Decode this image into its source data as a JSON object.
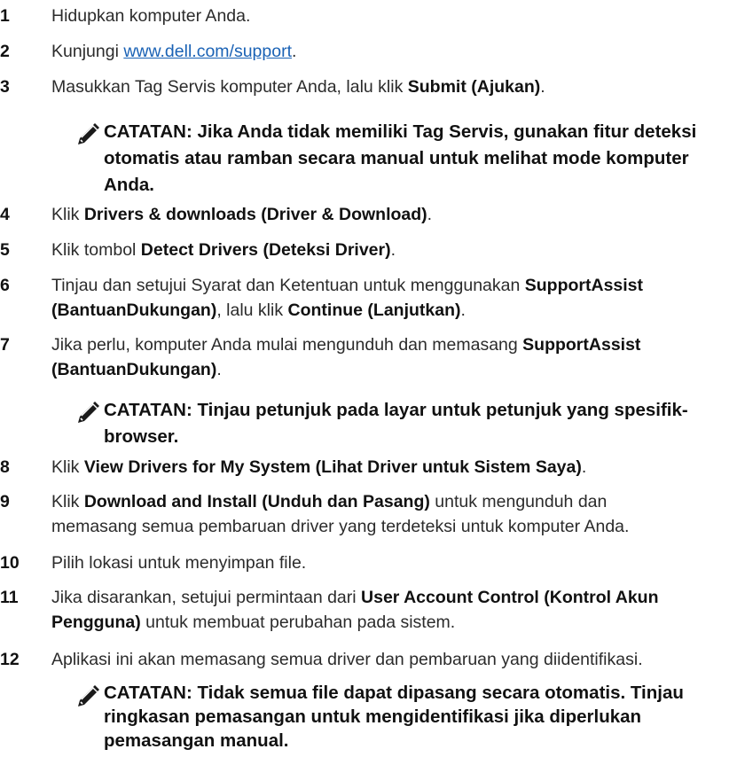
{
  "steps": [
    {
      "num": "1",
      "text": "Hidupkan komputer Anda."
    },
    {
      "num": "2",
      "pre": "Kunjungi ",
      "link": "www.dell.com/support",
      "post": "."
    },
    {
      "num": "3",
      "pre": "Masukkan Tag Servis komputer Anda, lalu klik ",
      "bold": "Submit (Ajukan)",
      "post": "."
    },
    {
      "num": "4",
      "pre": "Klik ",
      "bold": "Drivers & downloads (Driver & Download)",
      "post": "."
    },
    {
      "num": "5",
      "pre": "Klik tombol ",
      "bold": "Detect Drivers (Deteksi Driver)",
      "post": "."
    },
    {
      "num": "6",
      "pre": "Tinjau dan setujui Syarat dan Ketentuan untuk menggunakan ",
      "bold1": "SupportAssist",
      "bold2": "(BantuanDukungan)",
      "mid": ", lalu klik ",
      "bold3": "Continue (Lanjutkan)",
      "post": "."
    },
    {
      "num": "7",
      "pre": "Jika perlu, komputer Anda mulai mengunduh dan memasang ",
      "bold1": "SupportAssist",
      "bold2": "(BantuanDukungan)",
      "post": "."
    },
    {
      "num": "8",
      "pre": "Klik ",
      "bold": "View Drivers for My System (Lihat Driver untuk Sistem Saya)",
      "post": "."
    },
    {
      "num": "9",
      "bold": "Klik ",
      "bold_label": "Download and Install (Unduh dan Pasang)",
      "line1_post": " untuk mengunduh dan",
      "line2": "memasang semua pembaruan driver yang terdeteksi untuk komputer Anda."
    },
    {
      "num": "10",
      "text": "Pilih lokasi untuk menyimpan file."
    },
    {
      "num": "11",
      "pre": "Jika disarankan, setujui permintaan dari ",
      "bold1": "User Account Control (Kontrol Akun",
      "bold2": "Pengguna)",
      "post": " untuk membuat perubahan pada sistem."
    },
    {
      "num": "12",
      "text": "Aplikasi ini akan memasang semua driver dan pembaruan yang diidentifikasi."
    }
  ],
  "notes": [
    {
      "lines": [
        "CATATAN: Jika Anda tidak memiliki Tag Servis, gunakan fitur deteksi",
        "otomatis atau ramban secara manual untuk melihat mode komputer",
        "Anda."
      ]
    },
    {
      "lines": [
        "CATATAN: Tinjau petunjuk pada layar untuk petunjuk yang spesifik-",
        "browser."
      ]
    },
    {
      "lines": [
        "CATATAN: Tidak semua file dapat dipasang secara otomatis. Tinjau",
        "ringkasan pemasangan untuk mengidentifikasi jika diperlukan",
        "pemasangan manual."
      ]
    }
  ],
  "icons": {
    "note": "pencil-note-icon"
  },
  "colors": {
    "link": "#1a62b5",
    "text": "#2b2b2b"
  }
}
